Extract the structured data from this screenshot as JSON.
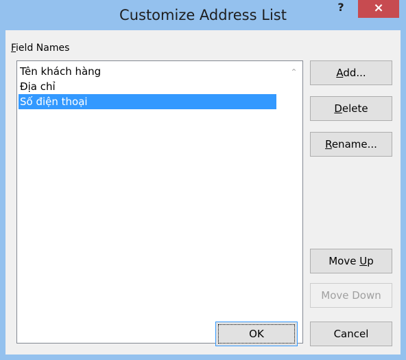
{
  "window": {
    "title": "Customize Address List",
    "help_label": "?",
    "close_label": "×"
  },
  "field_names": {
    "label_accel": "F",
    "label_rest": "ield Names",
    "items": [
      "Tên khách hàng",
      "Địa chỉ",
      "Số điện thoại"
    ],
    "selected_index": 2
  },
  "buttons": {
    "add": {
      "accel": "A",
      "rest": "dd..."
    },
    "delete": {
      "accel": "D",
      "rest": "elete"
    },
    "rename": {
      "accel": "R",
      "rest": "ename..."
    },
    "move_up": {
      "pre": "Move ",
      "accel": "U",
      "rest": "p"
    },
    "move_down": "Move Down",
    "ok": "OK",
    "cancel": "Cancel"
  },
  "colors": {
    "title_bar": "#94c1ee",
    "close_button": "#c74b50",
    "selection": "#3399ff"
  }
}
